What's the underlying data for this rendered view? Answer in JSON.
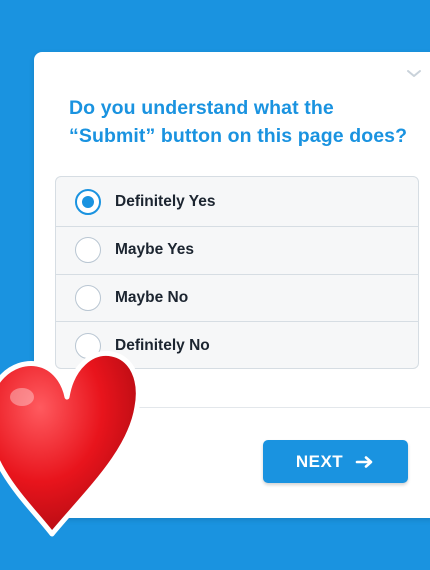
{
  "question": {
    "line1": "Do you understand what the",
    "line2": "“Submit” button on this page does?"
  },
  "options": [
    {
      "label": "Definitely Yes",
      "selected": true
    },
    {
      "label": "Maybe Yes",
      "selected": false
    },
    {
      "label": "Maybe No",
      "selected": false
    },
    {
      "label": "Definitely No",
      "selected": false
    }
  ],
  "next_button": {
    "label": "NEXT"
  },
  "colors": {
    "background": "#1a93e0",
    "accent": "#1a93e0",
    "heart": "#e8141c"
  },
  "icons": {
    "collapse": "chevron-down-icon",
    "next": "arrow-right-icon",
    "overlay": "red-heart-emoji"
  }
}
